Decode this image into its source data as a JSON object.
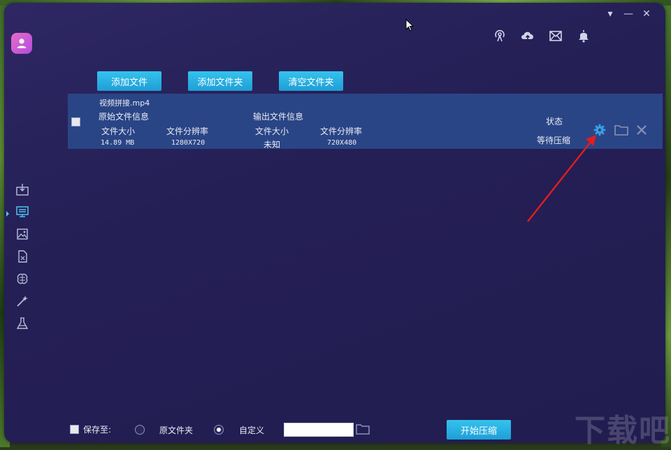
{
  "window": {
    "controls": [
      "▾",
      "—",
      "✕"
    ]
  },
  "top_icons": [
    "broadcast-icon",
    "cloud-upload-icon",
    "envelope-icon",
    "bell-icon"
  ],
  "toolbar": {
    "add_file": "添加文件",
    "add_folder": "添加文件夹",
    "clear_folder": "清空文件夹"
  },
  "sidebar": {
    "items": [
      {
        "icon": "video-compress-icon"
      },
      {
        "icon": "monitor-icon"
      },
      {
        "icon": "image-compress-icon"
      },
      {
        "icon": "document-icon"
      },
      {
        "icon": "brain-icon"
      },
      {
        "icon": "magic-wand-icon"
      },
      {
        "icon": "flask-icon"
      }
    ]
  },
  "file": {
    "name": "视频拼接.mp4",
    "original_header": "原始文件信息",
    "output_header": "输出文件信息",
    "size_label": "文件大小",
    "res_label": "文件分辨率",
    "orig_size": "14.89 MB",
    "orig_res": "1280X720",
    "out_size": "未知",
    "out_res": "720X480",
    "status_label": "状态",
    "status_value": "等待压缩"
  },
  "bottom": {
    "save_to": "保存至:",
    "original_folder": "原文件夹",
    "custom": "自定义",
    "path_value": "",
    "start": "开始压缩"
  },
  "watermark": {
    "main": "下载吧"
  },
  "colors": {
    "accent": "#29b3e6",
    "row": "#2a4585",
    "bg": "#251f57",
    "arrow": "#e01e1e"
  }
}
